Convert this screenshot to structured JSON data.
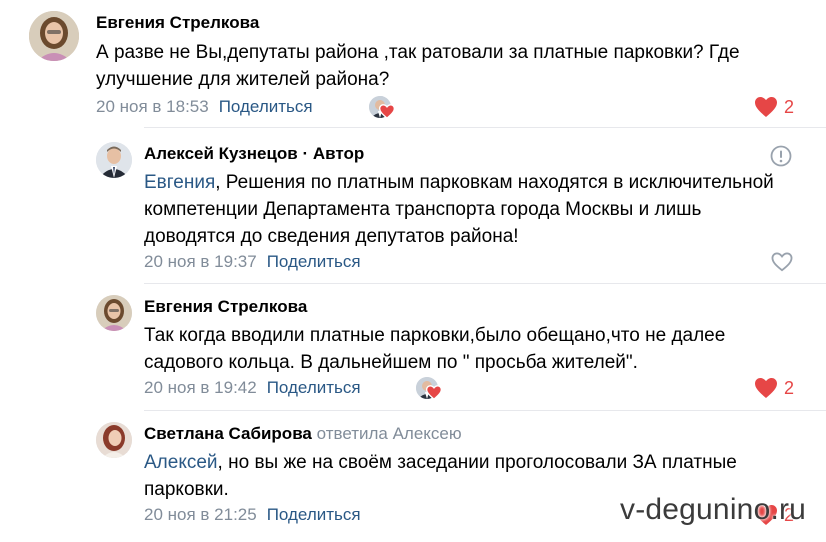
{
  "comments": [
    {
      "author": "Евгения Стрелкова",
      "author_suffix": "",
      "reply_to": "",
      "mention": "",
      "text": "А разве не Вы,депутаты района ,так ратовали за платные парковки? Где улучшение для жителей района?",
      "time": "20 ноя в 18:53",
      "share_label": "Поделиться",
      "likes": "2"
    },
    {
      "author": "Алексей Кузнецов",
      "author_suffix": " · Автор",
      "reply_to": "",
      "mention": "Евгения",
      "text": ", Решения по платным парковкам находятся в исключительной компетенции Департамента транспорта города Москвы и лишь доводятся до сведения депутатов района!",
      "time": "20 ноя в 19:37",
      "share_label": "Поделиться",
      "likes": ""
    },
    {
      "author": "Евгения Стрелкова",
      "author_suffix": "",
      "reply_to": "",
      "mention": "",
      "text": "Так когда вводили платные парковки,было обещано,что не далее садового кольца. В дальнейшем по \" просьба жителей\".",
      "time": "20 ноя в 19:42",
      "share_label": "Поделиться",
      "likes": "2"
    },
    {
      "author": "Светлана Сабирова",
      "author_suffix": "",
      "reply_to": "ответила Алексею",
      "mention": "Алексей",
      "text": ", но вы же на своём заседании проголосовали ЗА платные парковки.",
      "time": "20 ноя в 21:25",
      "share_label": "Поделиться",
      "likes": "2"
    }
  ],
  "watermark": "v-degunino.ru",
  "colors": {
    "link": "#2a5885",
    "meta": "#818c99",
    "like": "#e64646",
    "divider": "#e7e8ec"
  }
}
